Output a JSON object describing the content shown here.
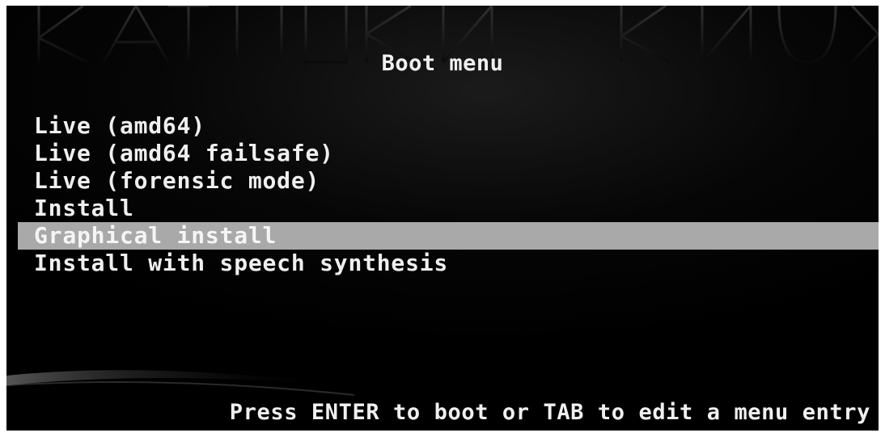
{
  "boot_screen": {
    "title": "Boot menu",
    "menu_items": [
      {
        "label": "Live (amd64)",
        "selected": false
      },
      {
        "label": "Live (amd64 failsafe)",
        "selected": false
      },
      {
        "label": "Live (forensic mode)",
        "selected": false
      },
      {
        "label": "Install",
        "selected": false
      },
      {
        "label": "Graphical install",
        "selected": true
      },
      {
        "label": "Install with speech synthesis",
        "selected": false
      }
    ],
    "footer_hint": "Press ENTER to boot or TAB to edit a menu entry",
    "colors": {
      "background": "#000000",
      "text": "#efefef",
      "selection_bar": "#a9a9a9"
    }
  }
}
